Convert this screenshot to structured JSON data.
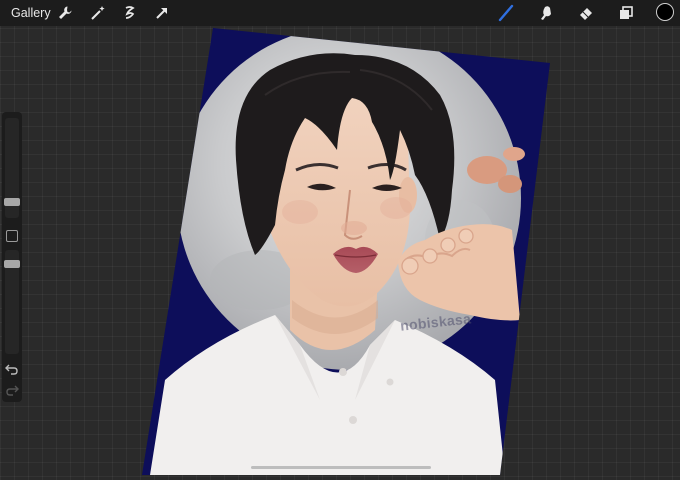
{
  "toolbar": {
    "gallery_label": "Gallery",
    "left_icons": [
      "wrench-icon",
      "magic-wand-icon",
      "selection-icon",
      "transform-arrow-icon"
    ],
    "right_icons": [
      "brush-icon",
      "smudge-icon",
      "eraser-icon",
      "layers-icon"
    ],
    "current_color": "#000000",
    "active_tool_color": "#2f6fe0"
  },
  "sidebar": {
    "brush_size_level": 0.25,
    "opacity_level": 0.25,
    "icons": [
      "modifier-square-icon",
      "undo-icon",
      "redo-icon"
    ]
  },
  "artwork": {
    "watermark": "nobiskasa",
    "background_color": "#0d0e5a",
    "moon_color": "#cfd0d2",
    "skin_swatches": [
      "#d99b80",
      "#e0a58b",
      "#d4967a"
    ]
  }
}
